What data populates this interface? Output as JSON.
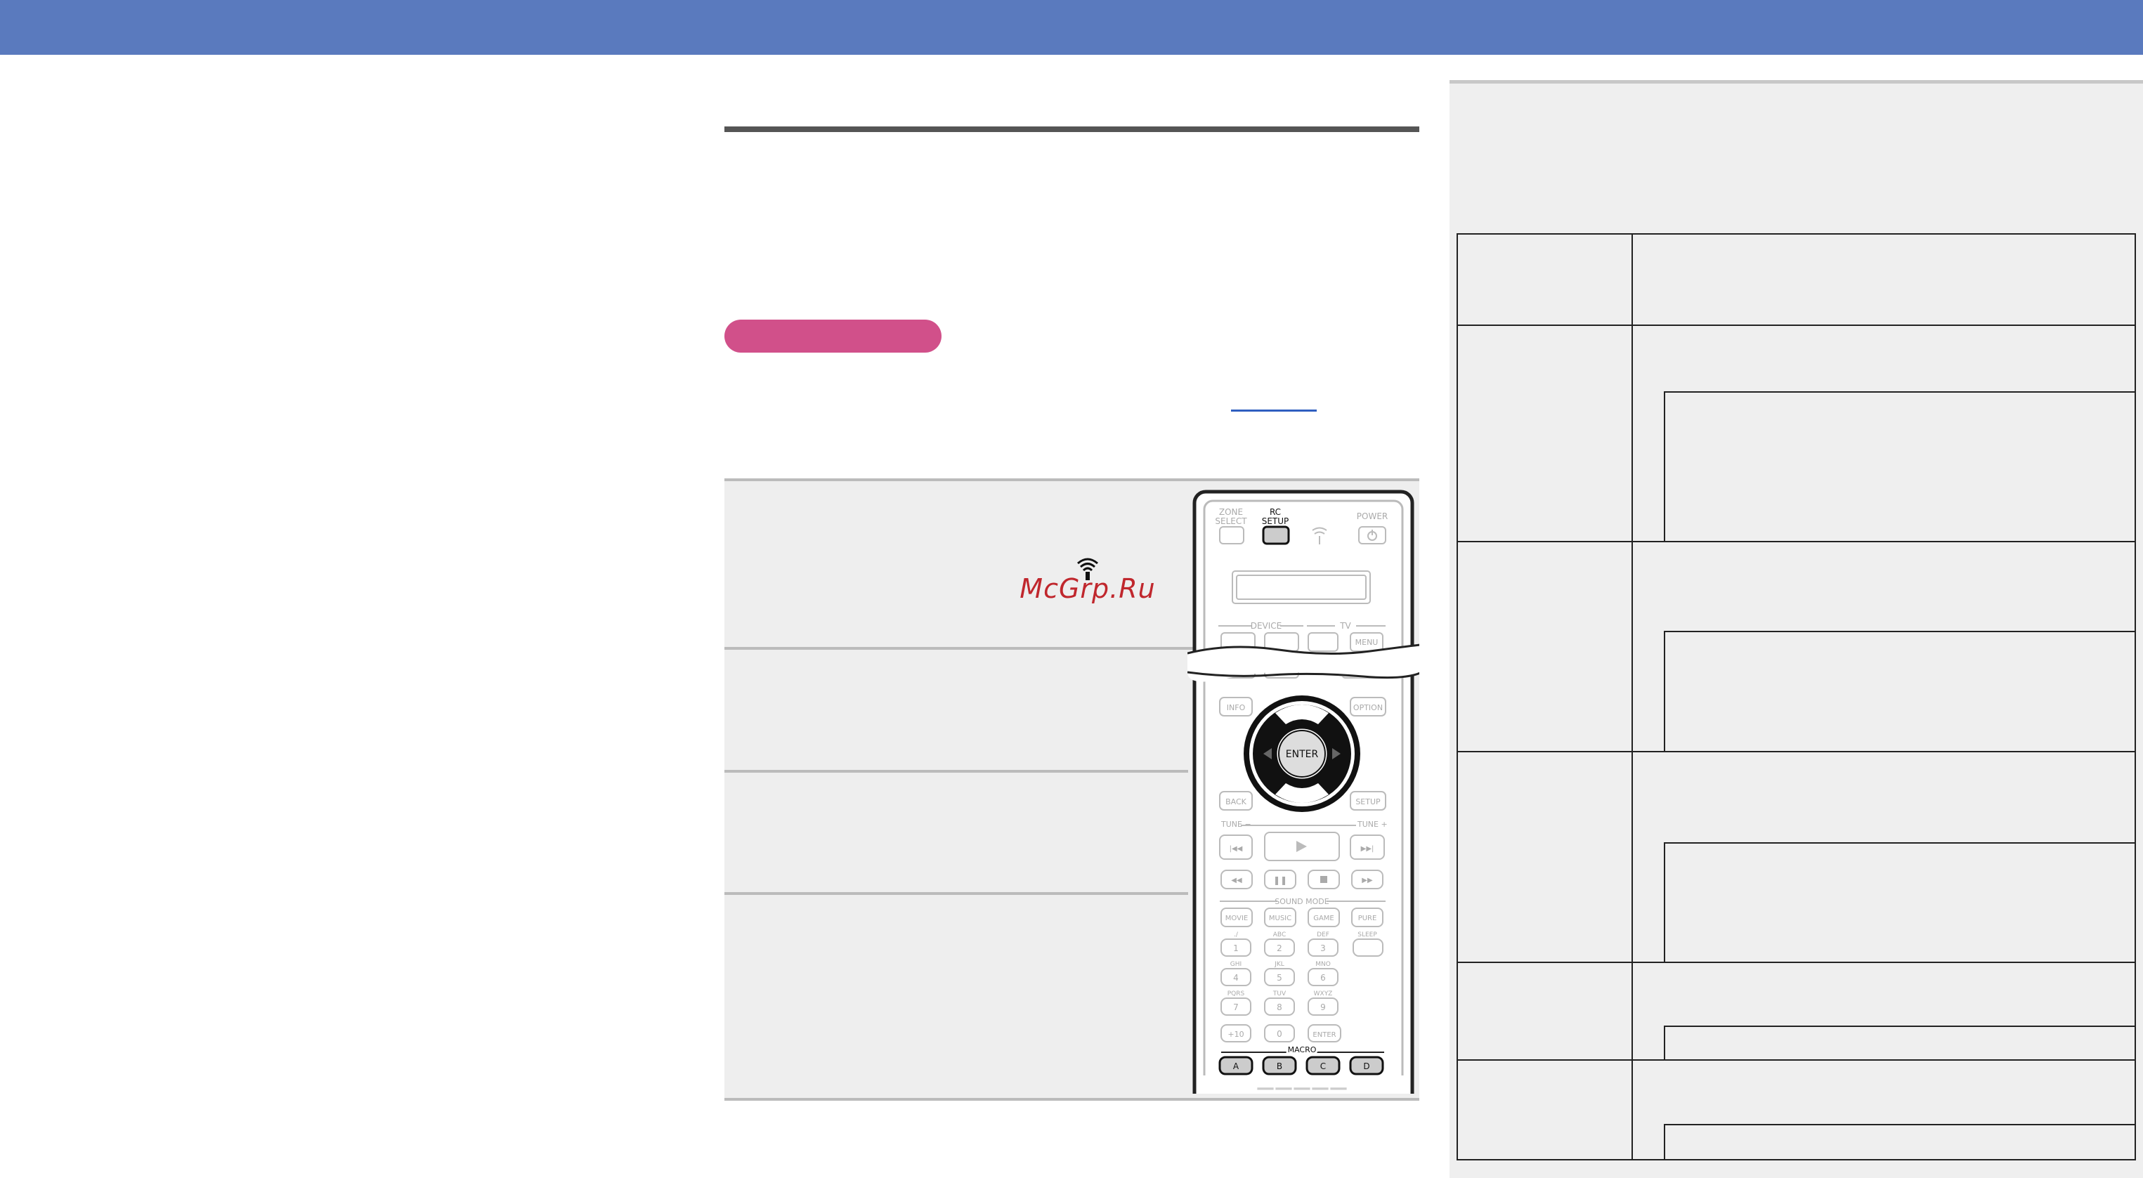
{
  "colors": {
    "header_bar": "#5a7abe",
    "tag_pill": "#d1508a",
    "link": "#2f5fc0",
    "step_background": "#eeeeee",
    "side_panel": "#efefef",
    "watermark": "#c0272d"
  },
  "watermark": {
    "text": "McGrp.Ru",
    "icon": "wifi-signal-icon"
  },
  "remote": {
    "top_labels": {
      "zone": "ZONE",
      "select": "SELECT",
      "rc": "RC",
      "setup": "SETUP",
      "power": "POWER"
    },
    "groups": {
      "device": "DEVICE",
      "tv": "TV",
      "sound_mode": "SOUND MODE",
      "macro": "MACRO"
    },
    "nav_buttons": {
      "info": "INFO",
      "option": "OPTION",
      "back": "BACK",
      "setup": "SETUP",
      "menu": "MENU",
      "enter": "ENTER"
    },
    "tune": {
      "minus": "TUNE −",
      "plus": "TUNE +"
    },
    "sound_modes": [
      "MOVIE",
      "MUSIC",
      "GAME",
      "PURE"
    ],
    "keypad": [
      {
        "letters": "./",
        "num": "1"
      },
      {
        "letters": "ABC",
        "num": "2"
      },
      {
        "letters": "DEF",
        "num": "3"
      },
      {
        "letters": "GHI",
        "num": "4"
      },
      {
        "letters": "JKL",
        "num": "5"
      },
      {
        "letters": "MNO",
        "num": "6"
      },
      {
        "letters": "PQRS",
        "num": "7"
      },
      {
        "letters": "TUV",
        "num": "8"
      },
      {
        "letters": "WXYZ",
        "num": "9"
      }
    ],
    "sleep": "SLEEP",
    "plus10": "+10",
    "zero": "0",
    "keypad_enter": "ENTER",
    "macro_buttons": [
      "A",
      "B",
      "C",
      "D"
    ]
  }
}
